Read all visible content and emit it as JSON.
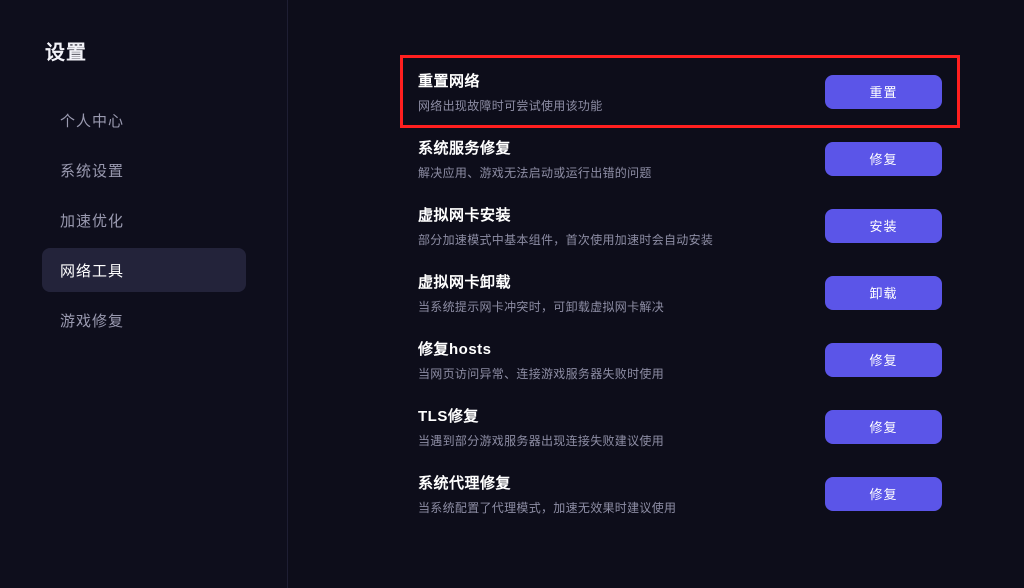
{
  "sidebar": {
    "title": "设置",
    "items": [
      {
        "label": "个人中心",
        "active": false
      },
      {
        "label": "系统设置",
        "active": false
      },
      {
        "label": "加速优化",
        "active": false
      },
      {
        "label": "网络工具",
        "active": true
      },
      {
        "label": "游戏修复",
        "active": false
      }
    ]
  },
  "main": {
    "highlight_color": "#ff1f1f",
    "accent_color": "#5b55e8",
    "rows": [
      {
        "title": "重置网络",
        "desc": "网络出现故障时可尝试使用该功能",
        "button": "重置",
        "highlighted": true
      },
      {
        "title": "系统服务修复",
        "desc": "解决应用、游戏无法启动或运行出错的问题",
        "button": "修复",
        "highlighted": false
      },
      {
        "title": "虚拟网卡安装",
        "desc": "部分加速模式中基本组件，首次使用加速时会自动安装",
        "button": "安装",
        "highlighted": false
      },
      {
        "title": "虚拟网卡卸载",
        "desc": "当系统提示网卡冲突时，可卸载虚拟网卡解决",
        "button": "卸载",
        "highlighted": false
      },
      {
        "title": "修复hosts",
        "desc": "当网页访问异常、连接游戏服务器失败时使用",
        "button": "修复",
        "highlighted": false
      },
      {
        "title": "TLS修复",
        "desc": "当遇到部分游戏服务器出现连接失败建议使用",
        "button": "修复",
        "highlighted": false
      },
      {
        "title": "系统代理修复",
        "desc": "当系统配置了代理模式，加速无效果时建议使用",
        "button": "修复",
        "highlighted": false
      }
    ]
  }
}
